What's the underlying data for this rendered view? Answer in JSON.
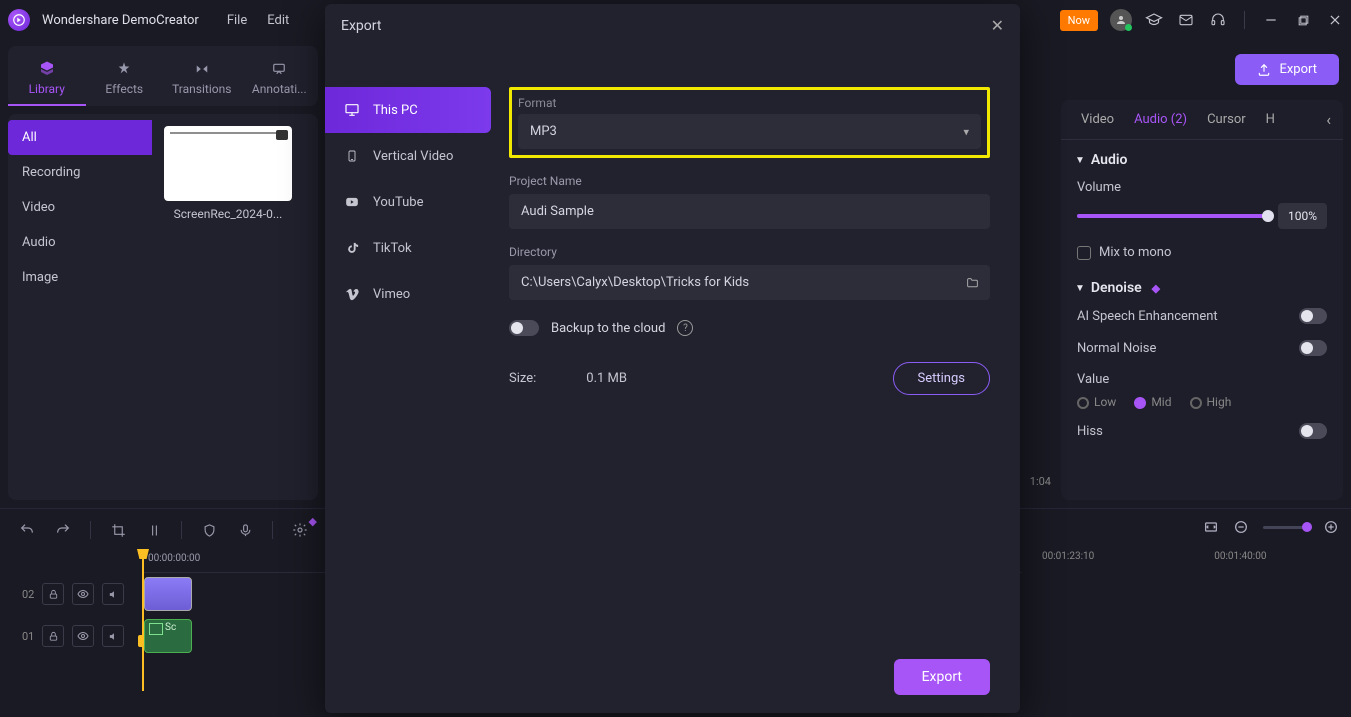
{
  "app": {
    "title": "Wondershare DemoCreator"
  },
  "menubar": {
    "file": "File",
    "edit": "Edit"
  },
  "titlebar": {
    "buy_now": "Now"
  },
  "top_export": {
    "label": "Export"
  },
  "top_tabs": {
    "library": "Library",
    "effects": "Effects",
    "transitions": "Transitions",
    "annotations": "Annotati..."
  },
  "lib_side": {
    "all": "All",
    "recording": "Recording",
    "video": "Video",
    "audio": "Audio",
    "image": "Image"
  },
  "thumb": {
    "label": "ScreenRec_2024-0..."
  },
  "props": {
    "tabs": {
      "video": "Video",
      "audio": "Audio (2)",
      "cursor": "Cursor",
      "h": "H"
    },
    "audio_head": "Audio",
    "volume_label": "Volume",
    "volume_value": "100%",
    "mix_label": "Mix to mono",
    "denoise_head": "Denoise",
    "ai_speech": "AI Speech Enhancement",
    "normal_noise": "Normal Noise",
    "value_label": "Value",
    "low": "Low",
    "mid": "Mid",
    "high": "High",
    "hiss": "Hiss"
  },
  "timeline": {
    "ruler0": "00:00:00:00",
    "track1_num": "02",
    "track2_num": "01",
    "clip_b_label": "Sc",
    "right_t1": "00:01:23:10",
    "right_t2": "00:01:40:00",
    "behind_time": "1:04"
  },
  "modal": {
    "title": "Export",
    "side": {
      "this_pc": "This PC",
      "vertical": "Vertical Video",
      "youtube": "YouTube",
      "tiktok": "TikTok",
      "vimeo": "Vimeo"
    },
    "format_label": "Format",
    "format_value": "MP3",
    "project_label": "Project Name",
    "project_value": "Audi Sample",
    "directory_label": "Directory",
    "directory_value": "C:\\Users\\Calyx\\Desktop\\Tricks for Kids",
    "backup_label": "Backup to the cloud",
    "size_label": "Size:",
    "size_value": "0.1 MB",
    "settings_btn": "Settings",
    "export_btn": "Export"
  }
}
